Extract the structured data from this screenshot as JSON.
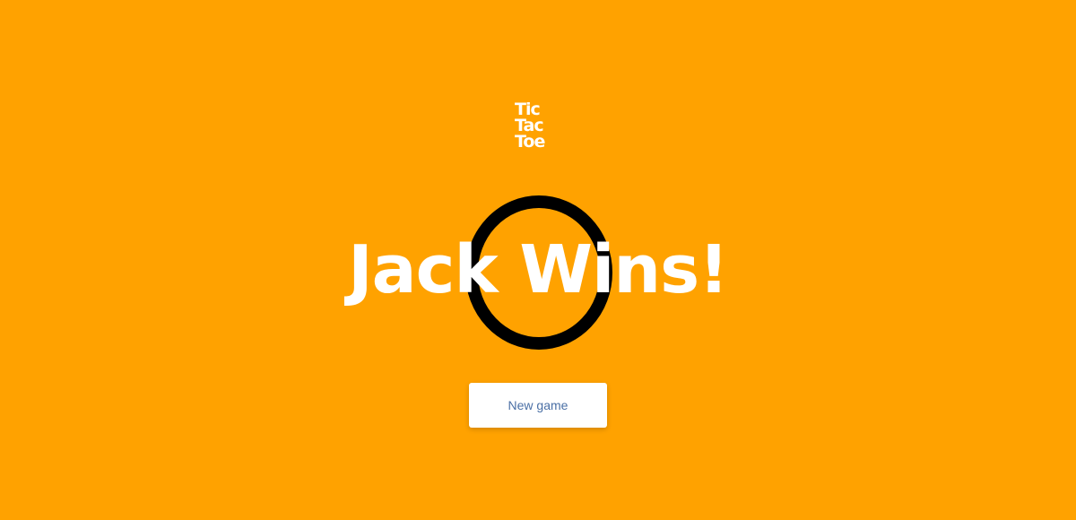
{
  "logo": {
    "lines": [
      "Tic",
      "Tac",
      "Toe"
    ]
  },
  "result": {
    "message": "Jack Wins!",
    "winning_mark": "O",
    "winning_mark_icon": "o-mark-icon"
  },
  "actions": {
    "new_game_label": "New game"
  },
  "colors": {
    "background": "#ffa200",
    "text": "#ffffff",
    "mark": "#000000",
    "button_text": "#4a6fa5"
  }
}
